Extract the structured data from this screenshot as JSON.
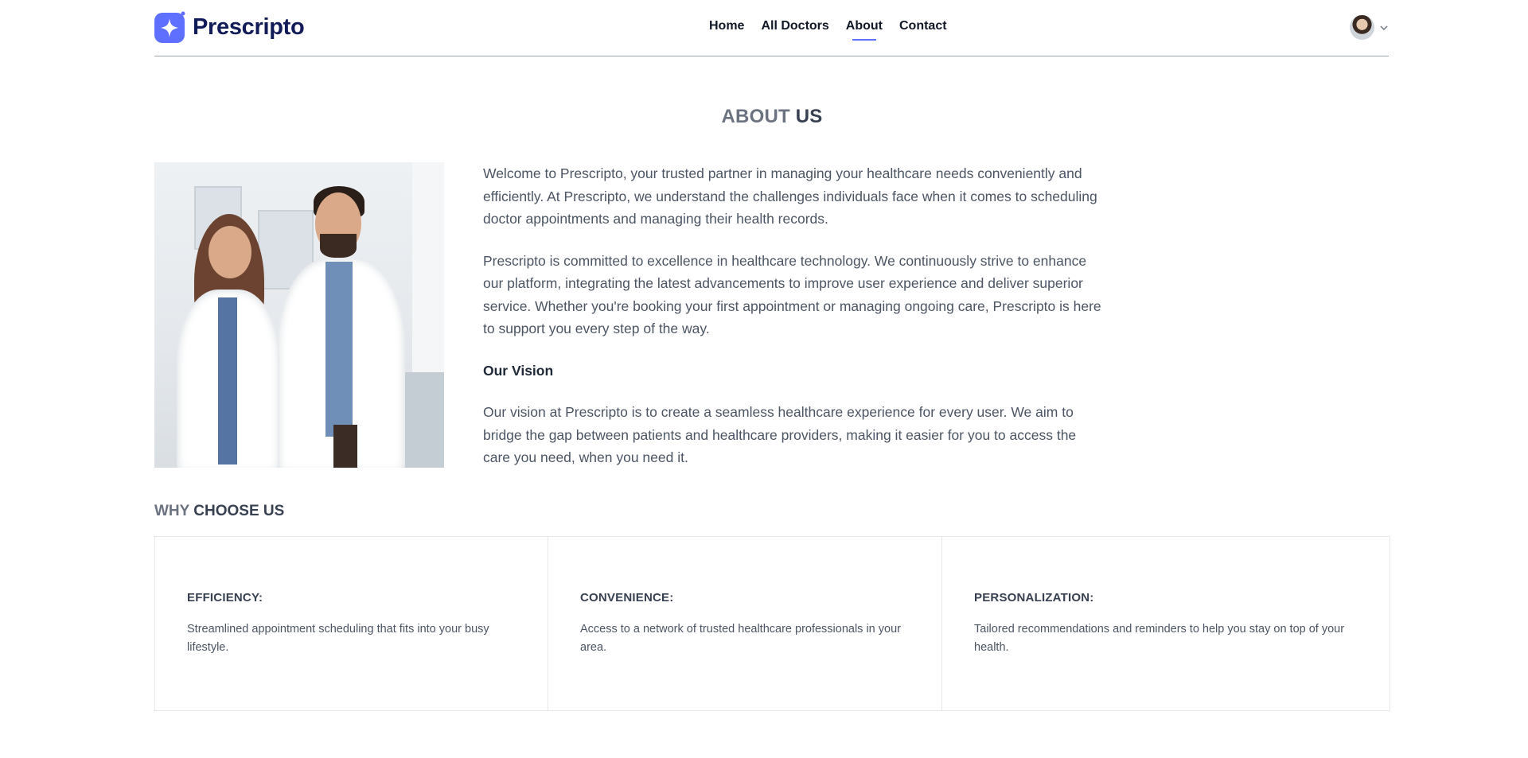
{
  "brand": {
    "name": "Prescripto",
    "accent_color": "#5f6fff",
    "logo_color": "#101b57"
  },
  "nav": {
    "links": [
      {
        "label": "Home",
        "active": false
      },
      {
        "label": "All Doctors",
        "active": false
      },
      {
        "label": "About",
        "active": true
      },
      {
        "label": "Contact",
        "active": false
      }
    ],
    "profile_icon": "user-avatar",
    "dropdown_icon": "chevron-down-icon"
  },
  "about": {
    "title_light": "ABOUT",
    "title_bold": "US",
    "paragraph1": "Welcome to Prescripto, your trusted partner in managing your healthcare needs conveniently and efficiently. At Prescripto, we understand the challenges individuals face when it comes to scheduling doctor appointments and managing their health records.",
    "paragraph2": "Prescripto is committed to excellence in healthcare technology. We continuously strive to enhance our platform, integrating the latest advancements to improve user experience and deliver superior service. Whether you're booking your first appointment or managing ongoing care, Prescripto is here to support you every step of the way.",
    "vision_title": "Our Vision",
    "vision_text": "Our vision at Prescripto is to create a seamless healthcare experience for every user. We aim to bridge the gap between patients and healthcare providers, making it easier for you to access the care you need, when you need it."
  },
  "why": {
    "title_light": "WHY",
    "title_bold": "CHOOSE US",
    "cards": [
      {
        "title": "EFFICIENCY:",
        "description": "Streamlined appointment scheduling that fits into your busy lifestyle."
      },
      {
        "title": "CONVENIENCE:",
        "description": "Access to a network of trusted healthcare professionals in your area."
      },
      {
        "title": "PERSONALIZATION:",
        "description": "Tailored recommendations and reminders to help you stay on top of your health."
      }
    ]
  }
}
